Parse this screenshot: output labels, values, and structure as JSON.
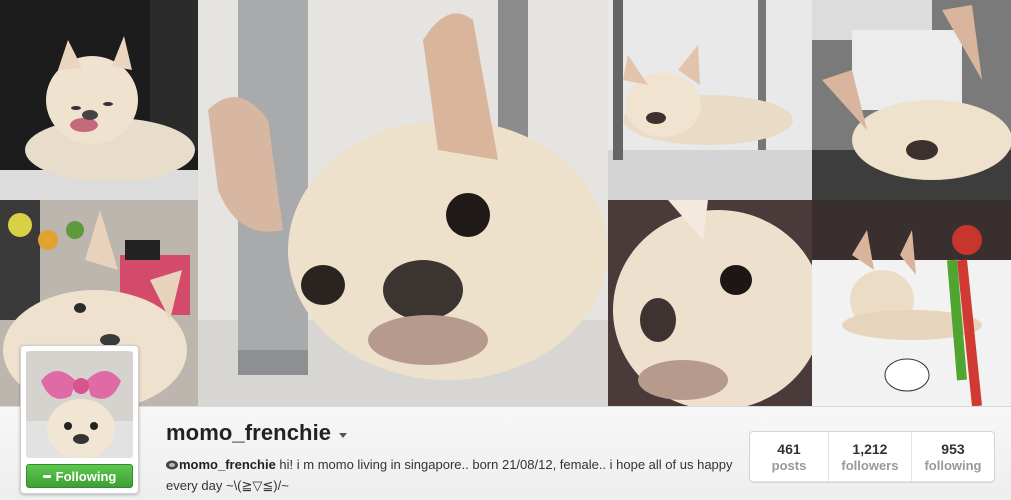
{
  "profile": {
    "username": "momo_frenchie",
    "follow_button_label": "Following",
    "bio_handle": "momo_frenchie",
    "bio_text": " hi! i m momo living in singapore.. born 21/08/12, female.. i hope all of us happy every day ~\\(≧▽≦)/~"
  },
  "stats": [
    {
      "value": "461",
      "label": "posts"
    },
    {
      "value": "1,212",
      "label": "followers"
    },
    {
      "value": "953",
      "label": "following"
    }
  ],
  "colors": {
    "follow_green": "#4cae40",
    "stat_label": "#999999",
    "username": "#222222"
  },
  "icons": {
    "follow": "check-icon",
    "bio": "badge-icon",
    "menu": "caret-down-icon"
  }
}
